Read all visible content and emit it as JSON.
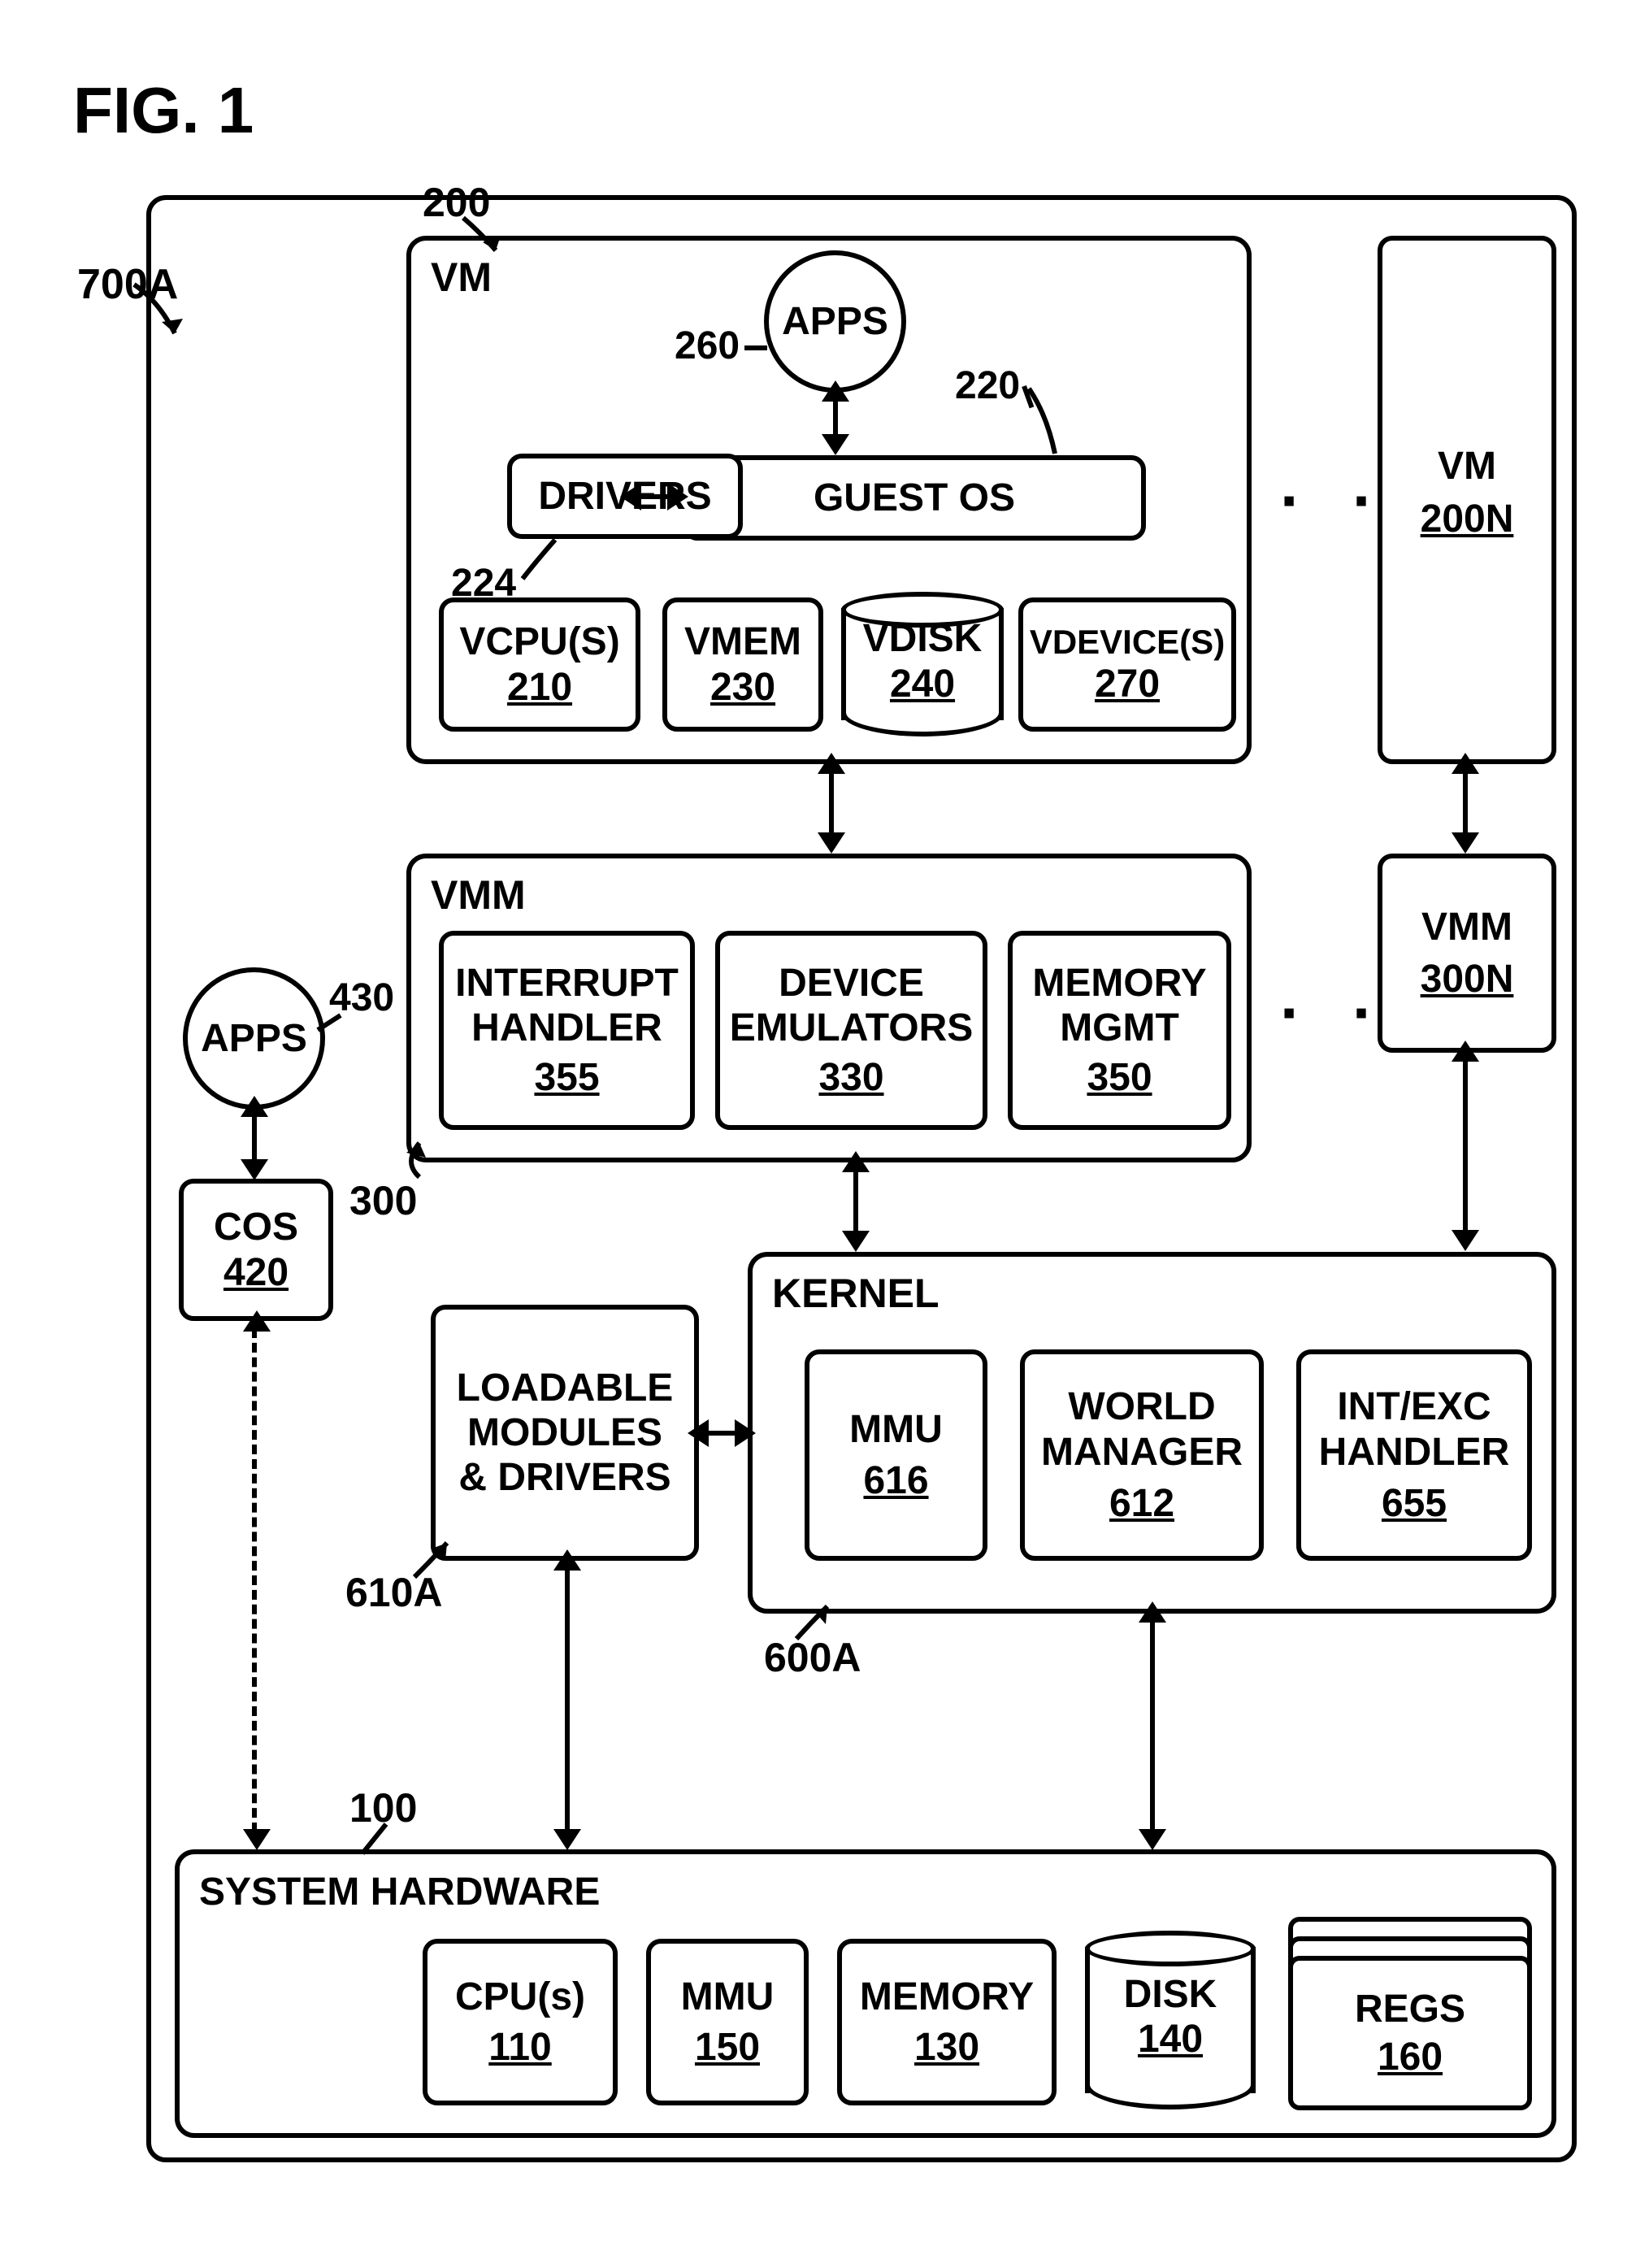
{
  "figure_label": "FIG. 1",
  "outer_ref": "700A",
  "vm": {
    "label": "VM",
    "ref": "200",
    "guest_os": {
      "label": "GUEST OS",
      "ref": "220"
    },
    "drivers": {
      "label": "DRIVERS",
      "ref": "224"
    },
    "apps": {
      "label": "APPS",
      "ref": "260"
    },
    "vcpu": {
      "label": "VCPU(S)",
      "ref": "210"
    },
    "vmem": {
      "label": "VMEM",
      "ref": "230"
    },
    "vdisk": {
      "label": "VDISK",
      "ref": "240"
    },
    "vdev": {
      "label": "VDEVICE(S)",
      "ref": "270"
    }
  },
  "vm_n": {
    "label": "VM",
    "ref": "200N"
  },
  "vmm": {
    "label": "VMM",
    "ref": "300",
    "int_handler": {
      "label": "INTERRUPT\nHANDLER",
      "ref": "355"
    },
    "dev_emu": {
      "label": "DEVICE\nEMULATORS",
      "ref": "330"
    },
    "mem_mgmt": {
      "label": "MEMORY\nMGMT",
      "ref": "350"
    }
  },
  "vmm_n": {
    "label": "VMM",
    "ref": "300N"
  },
  "cos": {
    "label": "COS",
    "ref": "420"
  },
  "cos_apps": {
    "label": "APPS",
    "ref": "430"
  },
  "loadable": {
    "label": "LOADABLE\nMODULES\n& DRIVERS",
    "ref": "610A"
  },
  "kernel": {
    "label": "KERNEL",
    "ref": "600A",
    "mmu": {
      "label": "MMU",
      "ref": "616"
    },
    "world_mgr": {
      "label": "WORLD\nMANAGER",
      "ref": "612"
    },
    "int_exc": {
      "label": "INT/EXC\nHANDLER",
      "ref": "655"
    }
  },
  "hardware": {
    "label": "SYSTEM HARDWARE",
    "ref": "100",
    "cpu": {
      "label": "CPU(s)",
      "ref": "110"
    },
    "mmu": {
      "label": "MMU",
      "ref": "150"
    },
    "memory": {
      "label": "MEMORY",
      "ref": "130"
    },
    "disk": {
      "label": "DISK",
      "ref": "140"
    },
    "regs": {
      "label": "REGS",
      "ref": "160"
    }
  }
}
